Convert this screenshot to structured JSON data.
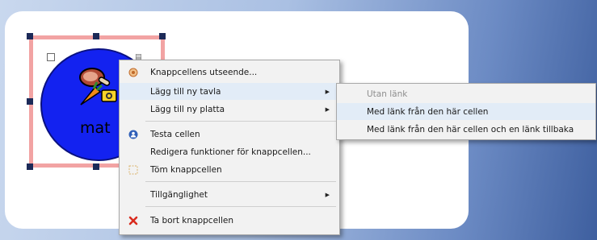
{
  "cell": {
    "label": "mat"
  },
  "context_menu": {
    "items": [
      {
        "label": "Knappcellens utseende...",
        "icon": "appearance-icon"
      },
      {
        "label": "Lägg till ny tavla",
        "submenu": true
      },
      {
        "label": "Lägg till ny platta",
        "submenu": true
      },
      {
        "label": "Testa cellen",
        "icon": "test-icon"
      },
      {
        "label": "Redigera funktioner för knappcellen..."
      },
      {
        "label": "Töm knappcellen",
        "icon": "clear-icon"
      },
      {
        "label": "Tillgänglighet",
        "submenu": true
      },
      {
        "label": "Ta bort knappcellen",
        "icon": "delete-icon"
      }
    ]
  },
  "submenu": {
    "items": [
      {
        "label": "Utan länk",
        "disabled": true
      },
      {
        "label": "Med länk från den här cellen",
        "highlighted": true
      },
      {
        "label": "Med länk från den här cellen och en länk tillbaka"
      }
    ]
  },
  "colors": {
    "cell_fill": "#1322f0",
    "selection_frame": "#f2a3a3",
    "delete_icon": "#d92b1e",
    "test_icon": "#2f5fb8"
  }
}
